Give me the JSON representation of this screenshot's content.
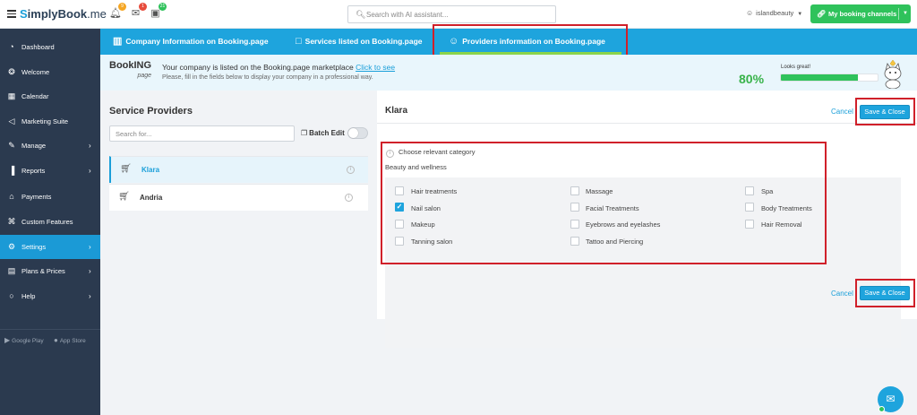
{
  "header": {
    "logo_initial": "S",
    "logo_text": "implyBook",
    "logo_suffix": ".me",
    "notifications_badge": "9",
    "messages_badge": "1",
    "calendar_badge": "21",
    "search_placeholder": "Search with AI assistant...",
    "username": "islandbeauty",
    "channels_label": "My booking channels"
  },
  "sidebar": {
    "items": [
      {
        "label": "Dashboard",
        "icon": "dashboard-icon"
      },
      {
        "label": "Welcome",
        "icon": "bulb-icon"
      },
      {
        "label": "Calendar",
        "icon": "calendar-icon"
      },
      {
        "label": "Marketing Suite",
        "icon": "megaphone-icon"
      },
      {
        "label": "Manage",
        "icon": "pencil-icon"
      },
      {
        "label": "Reports",
        "icon": "bar-chart-icon"
      },
      {
        "label": "Payments",
        "icon": "tag-icon"
      },
      {
        "label": "Custom Features",
        "icon": "gift-icon"
      },
      {
        "label": "Settings",
        "icon": "gear-icon"
      },
      {
        "label": "Plans & Prices",
        "icon": "cash-icon"
      },
      {
        "label": "Help",
        "icon": "chat-bubble-icon"
      }
    ],
    "google_play": "Google Play",
    "app_store": "App Store"
  },
  "tabs": [
    {
      "label": "Company Information on Booking.page"
    },
    {
      "label": "Services listed on Booking.page"
    },
    {
      "label": "Providers information on Booking.page"
    }
  ],
  "banner": {
    "logo_text": "BookING",
    "logo_sub": "page",
    "title": "Your company is listed on the Booking.page marketplace",
    "title_link": "Click to see",
    "subtitle": "Please, fill in the fields below to display your company in a professional way.",
    "progress_percent": "80%",
    "progress_value": 0.8,
    "progress_label": "Looks great!"
  },
  "providers": {
    "title": "Service Providers",
    "search_placeholder": "Search for...",
    "batch_edit_label": "Batch Edit",
    "items": [
      {
        "name": "Klara",
        "selected": true
      },
      {
        "name": "Andria",
        "selected": false
      }
    ]
  },
  "detail": {
    "title": "Klara",
    "cancel_label": "Cancel",
    "save_label": "Save & Close",
    "choose_label": "Choose relevant category",
    "group_label": "Beauty and wellness",
    "options": [
      {
        "label": "Hair treatments",
        "checked": false
      },
      {
        "label": "Massage",
        "checked": false
      },
      {
        "label": "Spa",
        "checked": false
      },
      {
        "label": "Nail salon",
        "checked": true
      },
      {
        "label": "Facial Treatments",
        "checked": false
      },
      {
        "label": "Body Treatments",
        "checked": false
      },
      {
        "label": "Makeup",
        "checked": false
      },
      {
        "label": "Eyebrows and eyelashes",
        "checked": false
      },
      {
        "label": "Hair Removal",
        "checked": false
      },
      {
        "label": "Tanning salon",
        "checked": false
      },
      {
        "label": "Tattoo and Piercing",
        "checked": false
      }
    ]
  },
  "colors": {
    "accent": "#1ea4dd",
    "sidebar_bg": "#2b3a4f",
    "success": "#2fc25b",
    "highlight": "#d0202a"
  }
}
